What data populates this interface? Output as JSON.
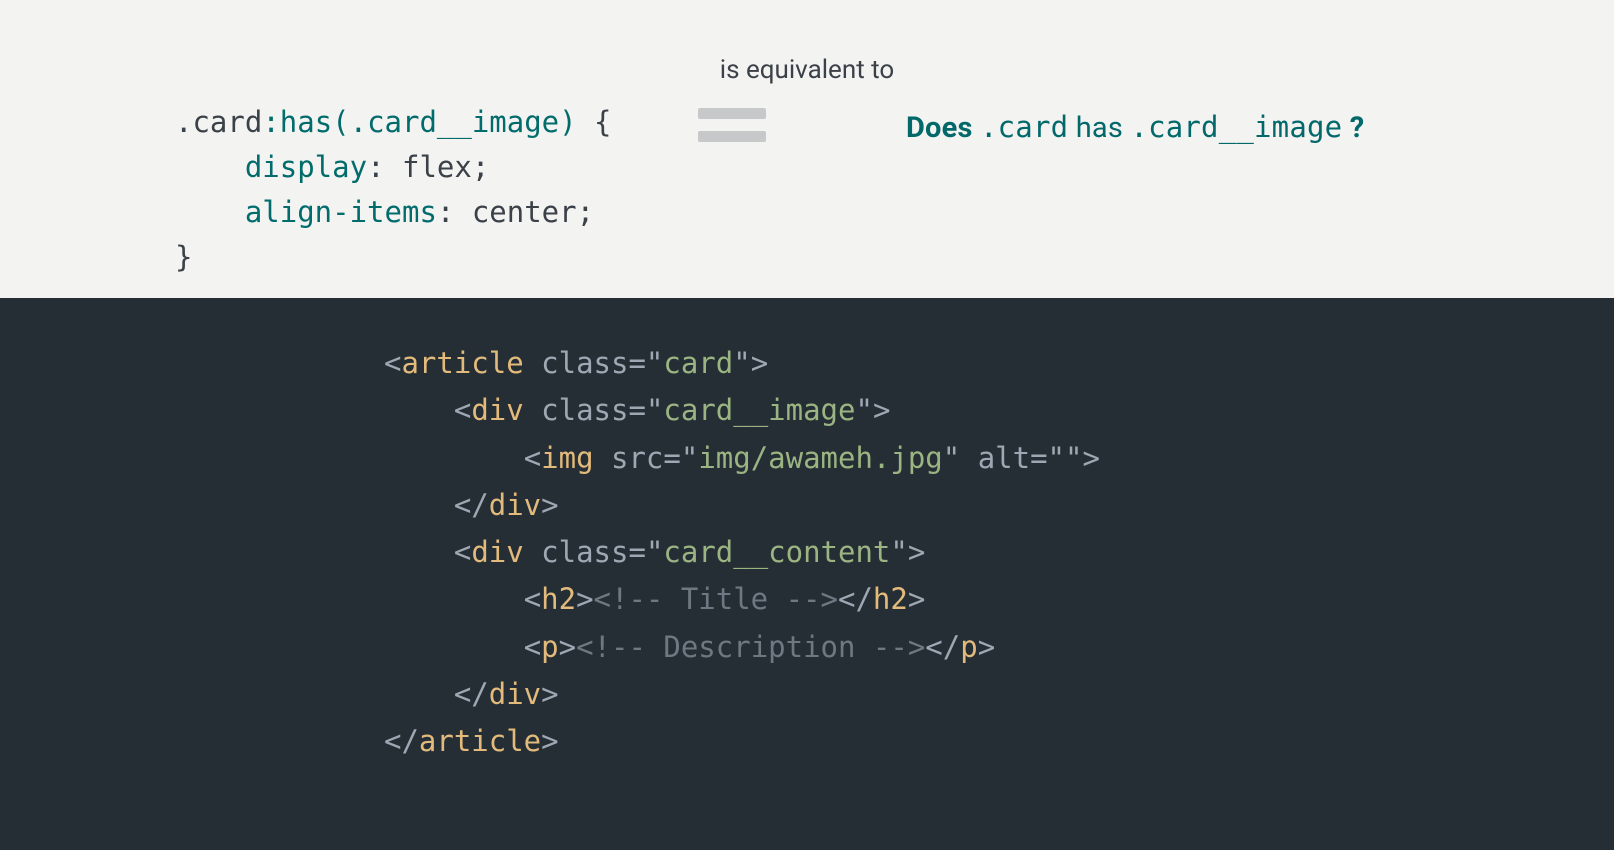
{
  "equiv_label": "is equivalent to",
  "css": {
    "line1_prefix": ".card",
    "line1_has": ":has(.card__image)",
    "line1_suffix": " {",
    "line2_indent": "    ",
    "line2_prop": "display",
    "line2_rest": ": flex;",
    "line3_indent": "    ",
    "line3_prop": "align-items",
    "line3_rest": ": center;",
    "line4": "}"
  },
  "question": {
    "does": "Does ",
    "card": ".card",
    "has": " has ",
    "card_image": ".card__image",
    "qmark": " ?"
  },
  "html": {
    "l1": {
      "open": "<",
      "tag": "article",
      "sp": " ",
      "attr": "class=",
      "q1": "\"",
      "val": "card",
      "q2": "\"",
      "close": ">"
    },
    "l2": {
      "indent": "    ",
      "open": "<",
      "tag": "div",
      "sp": " ",
      "attr": "class=",
      "q1": "\"",
      "val": "card__image",
      "q2": "\"",
      "close": ">"
    },
    "l3": {
      "indent": "        ",
      "open": "<",
      "tag": "img",
      "sp": " ",
      "attr1": "src=",
      "q1": "\"",
      "val1": "img/awameh.jpg",
      "q2": "\"",
      "sp2": " ",
      "attr2": "alt=",
      "q3": "\"",
      "val2": "",
      "q4": "\"",
      "close": ">"
    },
    "l4": {
      "indent": "    ",
      "open": "</",
      "tag": "div",
      "close": ">"
    },
    "l5": {
      "indent": "    ",
      "open": "<",
      "tag": "div",
      "sp": " ",
      "attr": "class=",
      "q1": "\"",
      "val": "card__content",
      "q2": "\"",
      "close": ">"
    },
    "l6": {
      "indent": "        ",
      "open": "<",
      "tag": "h2",
      "close1": ">",
      "cmt": "<!-- Title -->",
      "open2": "</",
      "tag2": "h2",
      "close2": ">"
    },
    "l7": {
      "indent": "        ",
      "open": "<",
      "tag": "p",
      "close1": ">",
      "cmt": "<!-- Description -->",
      "open2": "</",
      "tag2": "p",
      "close2": ">"
    },
    "l8": {
      "indent": "    ",
      "open": "</",
      "tag": "div",
      "close": ">"
    },
    "l9": {
      "open": "</",
      "tag": "article",
      "close": ">"
    }
  }
}
